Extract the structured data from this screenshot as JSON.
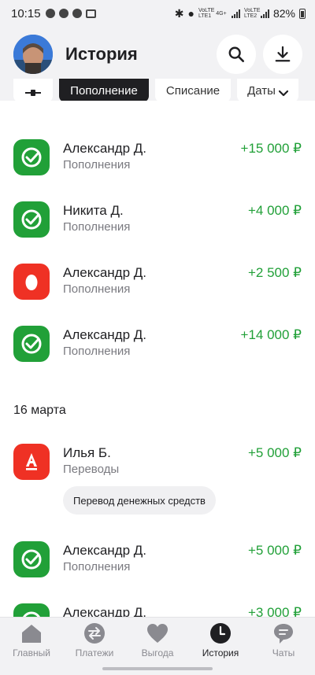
{
  "status_bar": {
    "time": "10:15",
    "network_1": "VoLTE LTE1",
    "network_2_type": "4G+",
    "network_3": "VoLTE LTE2",
    "battery": "82%"
  },
  "header": {
    "title": "История"
  },
  "filters": {
    "active": "Пополнение",
    "spisanie": "Списание",
    "dates": "Даты"
  },
  "transactions_top": [
    {
      "name": "Александр Д.",
      "category": "Пополнения",
      "amount": "+15 000 ₽",
      "bank": "sber"
    },
    {
      "name": "Никита Д.",
      "category": "Пополнения",
      "amount": "+4 000 ₽",
      "bank": "sber"
    },
    {
      "name": "Александр Д.",
      "category": "Пополнения",
      "amount": "+2 500 ₽",
      "bank": "egg"
    },
    {
      "name": "Александр Д.",
      "category": "Пополнения",
      "amount": "+14 000 ₽",
      "bank": "sber"
    }
  ],
  "date_heading": "16 марта",
  "transactions_bottom": [
    {
      "name": "Илья Б.",
      "category": "Переводы",
      "amount": "+5 000 ₽",
      "bank": "alfa",
      "comment": "Перевод денежных средств"
    },
    {
      "name": "Александр Д.",
      "category": "Пополнения",
      "amount": "+5 000 ₽",
      "bank": "sber"
    },
    {
      "name": "Александр Д.",
      "category": "",
      "amount": "+3 000 ₽",
      "bank": "sber"
    }
  ],
  "nav": {
    "home": "Главный",
    "payments": "Платежи",
    "benefits": "Выгода",
    "history": "История",
    "chats": "Чаты"
  },
  "colors": {
    "income_green": "#21a038",
    "sber_green": "#21a038",
    "alfa_red": "#ef3124",
    "background": "#f2f2f4"
  }
}
